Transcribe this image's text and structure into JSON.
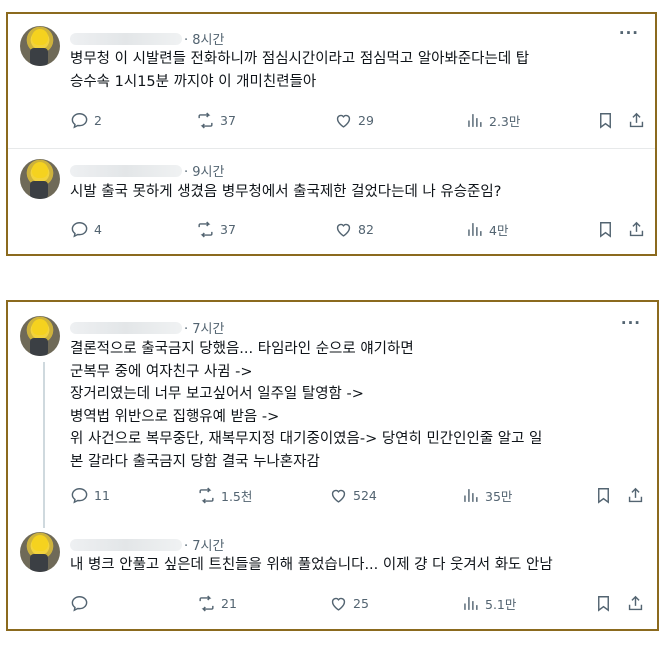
{
  "panel1": {
    "tweets": [
      {
        "time": "· 8시간",
        "lines": [
          "병무청 이 시발련들 전화하니까 점심시간이라고 점심먹고 알아봐준다는데 탑",
          "승수속 1시15분 까지야 이 개미친련들아"
        ],
        "reply": "2",
        "retweet": "37",
        "like": "29",
        "views": "2.3만"
      },
      {
        "time": "· 9시간",
        "lines": [
          "시발 출국 못하게 생겼음 병무청에서 출국제한 걸었다는데 나 유승준임?"
        ],
        "reply": "4",
        "retweet": "37",
        "like": "82",
        "views": "4만"
      }
    ]
  },
  "panel2": {
    "tweets": [
      {
        "time": "· 7시간",
        "lines": [
          "결론적으로 출국금지 당했음... 타임라인 순으로 얘기하면",
          "군복무 중에 여자친구 사귐 ->",
          "장거리였는데 너무 보고싶어서 일주일 탈영함 ->",
          "병역법 위반으로 집행유예 받음 ->",
          "위 사건으로 복무중단, 재복무지정 대기중이였음-> 당연히 민간인인줄 알고 일",
          "본 갈라다 출국금지 당함 결국 누나혼자감"
        ],
        "reply": "11",
        "retweet": "1.5천",
        "like": "524",
        "views": "35만"
      },
      {
        "time": "· 7시간",
        "lines": [
          "내 병크 안풀고 싶은데 트친들을 위해 풀었습니다... 이제 걍 다 웃겨서 화도 안남"
        ],
        "reply": "",
        "retweet": "21",
        "like": "25",
        "views": "5.1만"
      }
    ]
  },
  "more_label": "···",
  "icons": {
    "reply": "reply-icon",
    "retweet": "retweet-icon",
    "like": "like-icon",
    "views": "views-icon",
    "bookmark": "bookmark-icon",
    "share": "share-icon"
  },
  "colors": {
    "frame": "#8b6a1e",
    "muted": "#536471",
    "text": "#0f1419"
  }
}
